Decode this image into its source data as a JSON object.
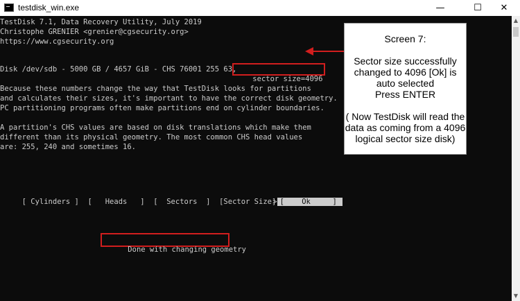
{
  "window": {
    "title": "testdisk_win.exe",
    "minimize_glyph": "—",
    "maximize_glyph": "☐",
    "close_glyph": "✕",
    "icon": "console-app-icon"
  },
  "console": {
    "header": [
      "TestDisk 7.1, Data Recovery Utility, July 2019",
      "Christophe GRENIER <grenier@cgsecurity.org>",
      "https://www.cgsecurity.org"
    ],
    "disk_prefix": "Disk /dev/sdb - 5000 GB / 4657 GiB - CHS 76001 255 63, ",
    "sector_size_text": "sector size=4096",
    "paragraph1": [
      "Because these numbers change the way that TestDisk looks for partitions",
      "and calculates their sizes, it's important to have the correct disk geometry.",
      "PC partitioning programs often make partitions end on cylinder boundaries."
    ],
    "paragraph2": [
      "A partition's CHS values are based on disk translations which make them",
      "different than its physical geometry. The most common CHS head values",
      "are: 255, 240 and sometimes 16."
    ],
    "menu": {
      "cylinders": " [ Cylinders ] ",
      "heads": " [   Heads   ] ",
      "sectors": " [  Sectors  ] ",
      "sector_size": " [Sector Size] ",
      "caret": ">",
      "ok": "[    Ok     ]"
    },
    "status": "Done with changing geometry"
  },
  "callout": {
    "lines": [
      "Screen 7:",
      "",
      "Sector size successfully",
      "changed to 4096 [Ok] is",
      "auto selected",
      "Press ENTER",
      "",
      "( Now TestDisk will read the",
      "data as coming from a 4096",
      "logical sector size disk)"
    ]
  },
  "colors": {
    "console_bg": "#0c0c0c",
    "console_fg": "#cccccc",
    "annotation_red": "#d21e1e"
  }
}
